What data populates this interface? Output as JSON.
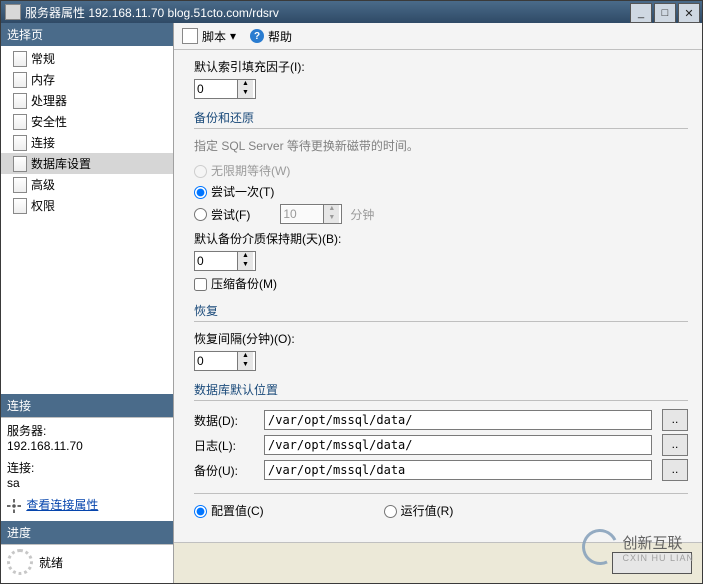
{
  "title": "服务器属性  192.168.11.70   blog.51cto.com/rdsrv",
  "toolbar": {
    "script": "脚本",
    "help": "帮助"
  },
  "sidebar": {
    "select_header": "选择页",
    "items": [
      "常规",
      "内存",
      "处理器",
      "安全性",
      "连接",
      "数据库设置",
      "高级",
      "权限"
    ],
    "selected_index": 5,
    "conn_header": "连接",
    "server_label": "服务器:",
    "server_value": "192.168.11.70",
    "connection_label": "连接:",
    "connection_value": "sa",
    "view_props": "查看连接属性",
    "progress_header": "进度",
    "ready": "就绪"
  },
  "main": {
    "fill_factor_label": "默认索引填充因子(I):",
    "fill_factor_value": "0",
    "backup_restore_header": "备份和还原",
    "backup_desc": "指定 SQL Server 等待更换新磁带的时间。",
    "wait_indef": "无限期等待(W)",
    "try_once": "尝试一次(T)",
    "try_for": "尝试(F)",
    "try_minutes_value": "10",
    "minutes_label": "分钟",
    "media_retention_label": "默认备份介质保持期(天)(B):",
    "media_retention_value": "0",
    "compress_backup": "压缩备份(M)",
    "recovery_header": "恢复",
    "recovery_interval_label": "恢复间隔(分钟)(O):",
    "recovery_interval_value": "0",
    "default_loc_header": "数据库默认位置",
    "data_label": "数据(D):",
    "data_path": "/var/opt/mssql/data/",
    "log_label": "日志(L):",
    "log_path": "/var/opt/mssql/data/",
    "backup_label": "备份(U):",
    "backup_path": "/var/opt/mssql/data",
    "config_value": "配置值(C)",
    "running_value": "运行值(R)"
  },
  "watermark": {
    "brand": "创新互联",
    "sub": "CXIN HU LIAN"
  }
}
